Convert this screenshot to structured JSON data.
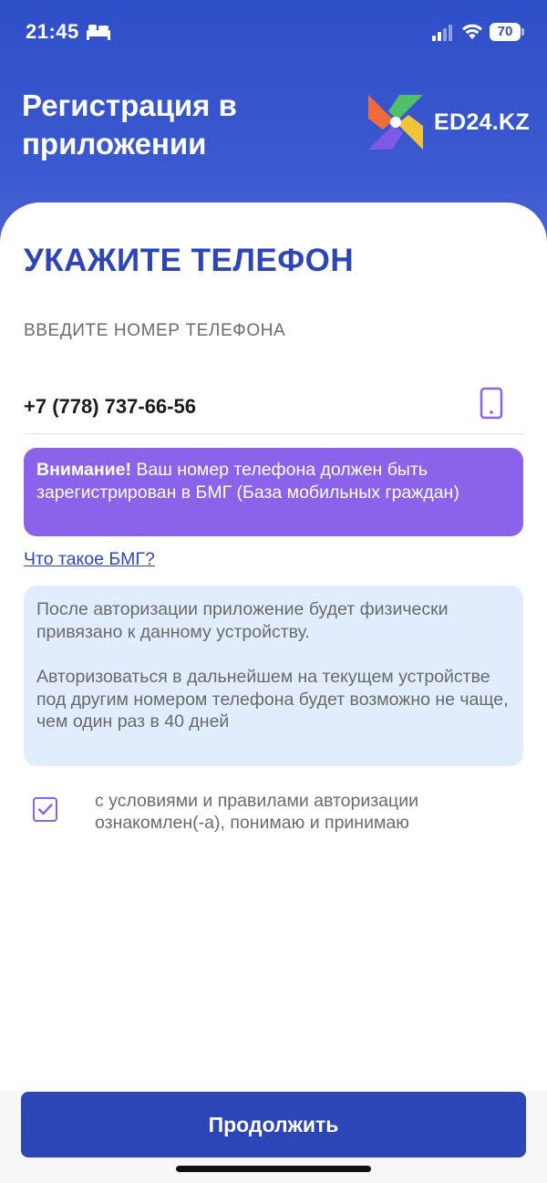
{
  "status_bar": {
    "time": "21:45",
    "battery": "70",
    "icons": [
      "bed-icon",
      "signal-icon",
      "wifi-icon",
      "battery-icon"
    ]
  },
  "header": {
    "title": "Регистрация в приложении",
    "logo_text": "ED24.KZ",
    "background_color": "#2f4fc9"
  },
  "form": {
    "section_title": "УКАЖИТЕ ТЕЛЕФОН",
    "phone_label": "ВВЕДИТЕ НОМЕР ТЕЛЕФОНА",
    "phone_value": "+7 (778) 737-66-56",
    "phone_icon": "mobile-phone-icon"
  },
  "warning": {
    "bold": "Внимание!",
    "text": " Ваш номер телефона должен быть зарегистрирован в БМГ (База мобильных граждан)",
    "color": "#8b63ea"
  },
  "bmg_link": "Что такое БМГ?",
  "info": {
    "paragraph_1": "После авторизации приложение будет физически привязано к данному устройству.",
    "paragraph_2": "Авторизоваться в дальнейшем на текущем устройстве под другим номером телефона будет возможно не чаще, чем один раз в 40 дней"
  },
  "consent": {
    "checked": true,
    "text": "с условиями и правилами авторизации ознакомлен(-а), понимаю и принимаю"
  },
  "continue_button": {
    "label": "Продолжить",
    "color": "#2c46b8"
  }
}
